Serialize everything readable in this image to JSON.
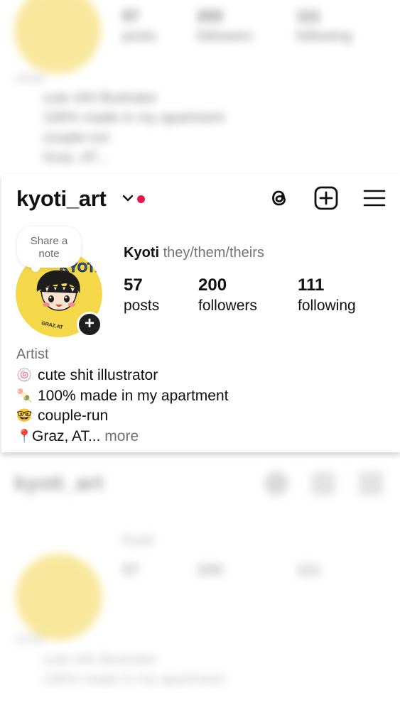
{
  "profile": {
    "username": "kyoti_art",
    "note_line1": "Share a",
    "note_line2": "note",
    "add_story_glyph": "+",
    "display_name": "Kyoti",
    "pronouns": "they/them/theirs",
    "avatar_text": "KYOTi",
    "avatar_sign": "GRAZ.AT"
  },
  "stats": [
    {
      "value": "57",
      "label": "posts"
    },
    {
      "value": "200",
      "label": "followers"
    },
    {
      "value": "111",
      "label": "following"
    }
  ],
  "bio": {
    "category": "Artist",
    "lines": [
      {
        "emoji": "🍥",
        "text": "cute shit illustrator"
      },
      {
        "emoji": "🍡",
        "text": "100% made in my apartment"
      },
      {
        "emoji": "🤓",
        "text": "couple-run"
      },
      {
        "emoji": "📍",
        "text": "Graz, AT..."
      }
    ],
    "more_label": " more"
  },
  "icons": [
    "chevron-down-icon",
    "threads-icon",
    "new-post-icon",
    "menu-icon"
  ],
  "colors": {
    "notification_dot": "#e8174a",
    "avatar_yellow": "#f5d84a",
    "text_secondary": "#737373"
  }
}
